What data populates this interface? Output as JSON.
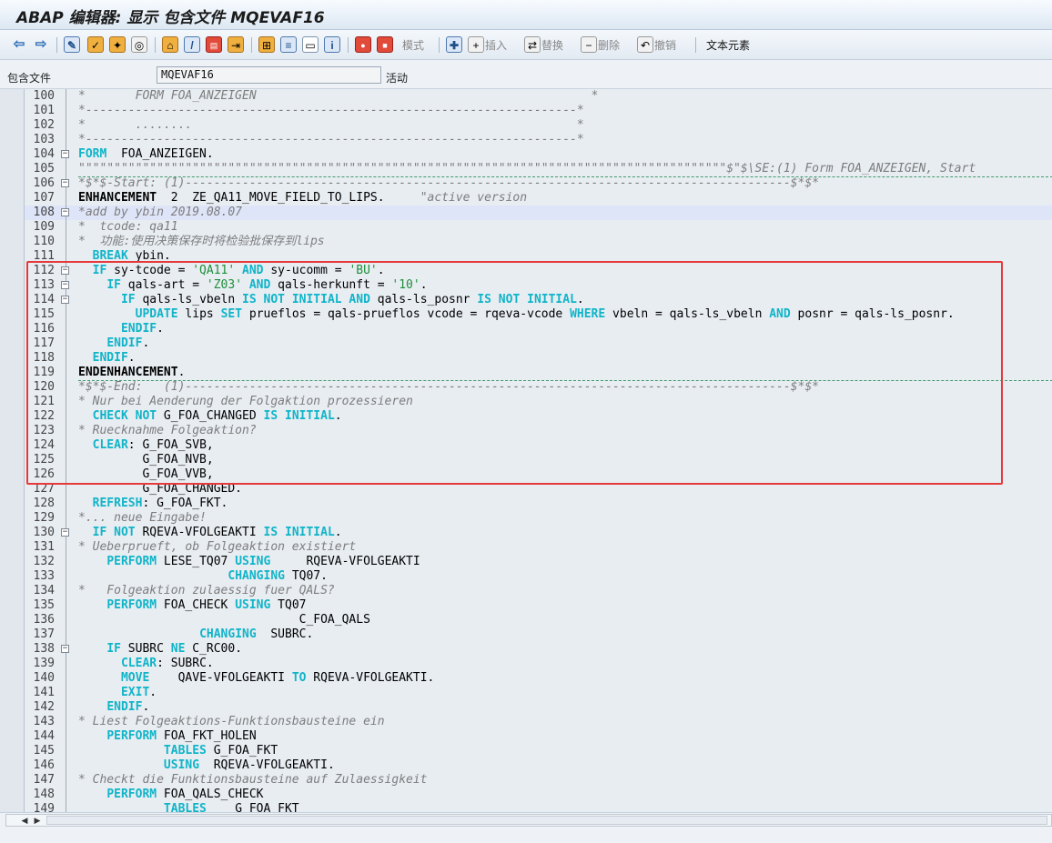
{
  "window": {
    "title": "ABAP 编辑器: 显示 包含文件 MQEVAF16"
  },
  "toolbar": {
    "mode_label": "模式",
    "insert_label": "插入",
    "replace_label": "替换",
    "delete_label": "删除",
    "undo_label": "撤销",
    "text_elements_label": "文本元素"
  },
  "fields": {
    "include_label": "包含文件",
    "include_value": "MQEVAF16",
    "status_value": "活动"
  },
  "lines": [
    {
      "num": "100",
      "fold": "line",
      "segs": [
        [
          "cm",
          "*       FORM FOA_ANZEIGEN                                               *"
        ]
      ]
    },
    {
      "num": "101",
      "fold": "line",
      "segs": [
        [
          "cm",
          "*---------------------------------------------------------------------*"
        ]
      ]
    },
    {
      "num": "102",
      "fold": "line",
      "segs": [
        [
          "cm",
          "*       ........                                                      *"
        ]
      ]
    },
    {
      "num": "103",
      "fold": "line",
      "segs": [
        [
          "cm",
          "*---------------------------------------------------------------------*"
        ]
      ]
    },
    {
      "num": "104",
      "fold": "box",
      "segs": [
        [
          "kw",
          "FORM"
        ],
        [
          "",
          "  FOA_ANZEIGEN."
        ]
      ]
    },
    {
      "num": "105",
      "fold": "line",
      "segs": [
        [
          "cm",
          "\"\"\"\"\"\"\"\"\"\"\"\"\"\"\"\"\"\"\"\"\"\"\"\"\"\"\"\"\"\"\"\"\"\"\"\"\"\"\"\"\"\"\"\"\"\"\"\"\"\"\"\"\"\"\"\"\"\"\"\"\"\"\"\"\"\"\"\"\"\"\"\"\"\"\"\"\"\"\"\"\"\"\"\"\"\"\"\"\"\"\"$\"$\\SE:(1) Form FOA_ANZEIGEN, Start"
        ]
      ]
    },
    {
      "num": "106",
      "fold": "box",
      "segs": [
        [
          "cm",
          "*$*$-Start: (1)-------------------------------------------------------------------------------------$*$*"
        ]
      ]
    },
    {
      "num": "107",
      "fold": "line",
      "segs": [
        [
          "bk",
          "ENHANCEMENT"
        ],
        [
          "",
          "  2  ZE_QA11_MOVE_FIELD_TO_LIPS.     "
        ],
        [
          "cm",
          "\"active version"
        ]
      ]
    },
    {
      "num": "108",
      "fold": "box",
      "hl": true,
      "segs": [
        [
          "cm",
          "*add by ybin 2019.08.07"
        ]
      ]
    },
    {
      "num": "109",
      "fold": "line",
      "segs": [
        [
          "cm",
          "*  tcode: qa11"
        ]
      ]
    },
    {
      "num": "110",
      "fold": "line",
      "segs": [
        [
          "cm",
          "*  功能:使用决策保存时将检验批保存到lips"
        ]
      ]
    },
    {
      "num": "111",
      "fold": "line",
      "segs": [
        [
          "",
          "  "
        ],
        [
          "kw",
          "BREAK"
        ],
        [
          "",
          " ybin."
        ]
      ]
    },
    {
      "num": "112",
      "fold": "box",
      "segs": [
        [
          "",
          "  "
        ],
        [
          "kw",
          "IF"
        ],
        [
          "",
          " sy-tcode = "
        ],
        [
          "st",
          "'QA11'"
        ],
        [
          "",
          " "
        ],
        [
          "kw",
          "AND"
        ],
        [
          "",
          " sy-ucomm = "
        ],
        [
          "st",
          "'BU'"
        ],
        [
          "",
          "."
        ]
      ]
    },
    {
      "num": "113",
      "fold": "box",
      "segs": [
        [
          "",
          "    "
        ],
        [
          "kw",
          "IF"
        ],
        [
          "",
          " qals-art = "
        ],
        [
          "st",
          "'Z03'"
        ],
        [
          "",
          " "
        ],
        [
          "kw",
          "AND"
        ],
        [
          "",
          " qals-herkunft = "
        ],
        [
          "st",
          "'10'"
        ],
        [
          "",
          "."
        ]
      ]
    },
    {
      "num": "114",
      "fold": "box",
      "segs": [
        [
          "",
          "      "
        ],
        [
          "kw",
          "IF"
        ],
        [
          "",
          " qals-ls_vbeln "
        ],
        [
          "kw",
          "IS NOT INITIAL AND"
        ],
        [
          "",
          " qals-ls_posnr "
        ],
        [
          "kw",
          "IS NOT INITIAL"
        ],
        [
          "",
          "."
        ]
      ]
    },
    {
      "num": "115",
      "fold": "line",
      "segs": [
        [
          "",
          "        "
        ],
        [
          "kw",
          "UPDATE"
        ],
        [
          "",
          " lips "
        ],
        [
          "kw",
          "SET"
        ],
        [
          "",
          " prueflos = qals-prueflos vcode = rqeva-vcode "
        ],
        [
          "kw",
          "WHERE"
        ],
        [
          "",
          " vbeln = qals-ls_vbeln "
        ],
        [
          "kw",
          "AND"
        ],
        [
          "",
          " posnr = qals-ls_posnr."
        ]
      ]
    },
    {
      "num": "116",
      "fold": "line",
      "segs": [
        [
          "",
          "      "
        ],
        [
          "kw",
          "ENDIF"
        ],
        [
          "",
          "."
        ]
      ]
    },
    {
      "num": "117",
      "fold": "line",
      "segs": [
        [
          "",
          "    "
        ],
        [
          "kw",
          "ENDIF"
        ],
        [
          "",
          "."
        ]
      ]
    },
    {
      "num": "118",
      "fold": "line",
      "segs": [
        [
          "",
          "  "
        ],
        [
          "kw",
          "ENDIF"
        ],
        [
          "",
          "."
        ]
      ]
    },
    {
      "num": "119",
      "fold": "line",
      "segs": [
        [
          "bk",
          "ENDENHANCEMENT"
        ],
        [
          "",
          "."
        ]
      ]
    },
    {
      "num": "120",
      "fold": "line",
      "segs": [
        [
          "cm",
          "*$*$-End:   (1)-------------------------------------------------------------------------------------$*$*"
        ]
      ]
    },
    {
      "num": "121",
      "fold": "line",
      "segs": [
        [
          "cm",
          "* Nur bei Aenderung der Folgaktion prozessieren"
        ]
      ]
    },
    {
      "num": "122",
      "fold": "line",
      "segs": [
        [
          "",
          "  "
        ],
        [
          "kw",
          "CHECK NOT"
        ],
        [
          "",
          " G_FOA_CHANGED "
        ],
        [
          "kw",
          "IS INITIAL"
        ],
        [
          "",
          "."
        ]
      ]
    },
    {
      "num": "123",
      "fold": "line",
      "segs": [
        [
          "cm",
          "* Ruecknahme Folgeaktion?"
        ]
      ]
    },
    {
      "num": "124",
      "fold": "line",
      "segs": [
        [
          "",
          "  "
        ],
        [
          "kw",
          "CLEAR"
        ],
        [
          "",
          ": G_FOA_SVB,"
        ]
      ]
    },
    {
      "num": "125",
      "fold": "line",
      "segs": [
        [
          "",
          "         G_FOA_NVB,"
        ]
      ]
    },
    {
      "num": "126",
      "fold": "line",
      "segs": [
        [
          "",
          "         G_FOA_VVB,"
        ]
      ]
    },
    {
      "num": "127",
      "fold": "line",
      "segs": [
        [
          "",
          "         G_FOA_CHANGED."
        ]
      ]
    },
    {
      "num": "128",
      "fold": "line",
      "segs": [
        [
          "",
          "  "
        ],
        [
          "kw",
          "REFRESH"
        ],
        [
          "",
          ": G_FOA_FKT."
        ]
      ]
    },
    {
      "num": "129",
      "fold": "line",
      "segs": [
        [
          "cm",
          "*... neue Eingabe!"
        ]
      ]
    },
    {
      "num": "130",
      "fold": "box",
      "segs": [
        [
          "",
          "  "
        ],
        [
          "kw",
          "IF NOT"
        ],
        [
          "",
          " RQEVA-VFOLGEAKTI "
        ],
        [
          "kw",
          "IS INITIAL"
        ],
        [
          "",
          "."
        ]
      ]
    },
    {
      "num": "131",
      "fold": "line",
      "segs": [
        [
          "cm",
          "* Ueberprueft, ob Folgeaktion existiert"
        ]
      ]
    },
    {
      "num": "132",
      "fold": "line",
      "segs": [
        [
          "",
          "    "
        ],
        [
          "kw",
          "PERFORM"
        ],
        [
          "",
          " LESE_TQ07 "
        ],
        [
          "kw",
          "USING"
        ],
        [
          "",
          "     RQEVA-VFOLGEAKTI"
        ]
      ]
    },
    {
      "num": "133",
      "fold": "line",
      "segs": [
        [
          "",
          "                     "
        ],
        [
          "kw",
          "CHANGING"
        ],
        [
          "",
          " TQ07."
        ]
      ]
    },
    {
      "num": "134",
      "fold": "line",
      "segs": [
        [
          "cm",
          "*   Folgeaktion zulaessig fuer QALS?"
        ]
      ]
    },
    {
      "num": "135",
      "fold": "line",
      "segs": [
        [
          "",
          "    "
        ],
        [
          "kw",
          "PERFORM"
        ],
        [
          "",
          " FOA_CHECK "
        ],
        [
          "kw",
          "USING"
        ],
        [
          "",
          " TQ07"
        ]
      ]
    },
    {
      "num": "136",
      "fold": "line",
      "segs": [
        [
          "",
          "                               C_FOA_QALS"
        ]
      ]
    },
    {
      "num": "137",
      "fold": "line",
      "segs": [
        [
          "",
          "                 "
        ],
        [
          "kw",
          "CHANGING"
        ],
        [
          "",
          "  SUBRC."
        ]
      ]
    },
    {
      "num": "138",
      "fold": "box",
      "segs": [
        [
          "",
          "    "
        ],
        [
          "kw",
          "IF"
        ],
        [
          "",
          " SUBRC "
        ],
        [
          "kw",
          "NE"
        ],
        [
          "",
          " C_RC00."
        ]
      ]
    },
    {
      "num": "139",
      "fold": "line",
      "segs": [
        [
          "",
          "      "
        ],
        [
          "kw",
          "CLEAR"
        ],
        [
          "",
          ": SUBRC."
        ]
      ]
    },
    {
      "num": "140",
      "fold": "line",
      "segs": [
        [
          "",
          "      "
        ],
        [
          "kw",
          "MOVE"
        ],
        [
          "",
          "    QAVE-VFOLGEAKTI "
        ],
        [
          "kw",
          "TO"
        ],
        [
          "",
          " RQEVA-VFOLGEAKTI."
        ]
      ]
    },
    {
      "num": "141",
      "fold": "line",
      "segs": [
        [
          "",
          "      "
        ],
        [
          "kw",
          "EXIT"
        ],
        [
          "",
          "."
        ]
      ]
    },
    {
      "num": "142",
      "fold": "line",
      "segs": [
        [
          "",
          "    "
        ],
        [
          "kw",
          "ENDIF"
        ],
        [
          "",
          "."
        ]
      ]
    },
    {
      "num": "143",
      "fold": "line",
      "segs": [
        [
          "cm",
          "* Liest Folgeaktions-Funktionsbausteine ein"
        ]
      ]
    },
    {
      "num": "144",
      "fold": "line",
      "segs": [
        [
          "",
          "    "
        ],
        [
          "kw",
          "PERFORM"
        ],
        [
          "",
          " FOA_FKT_HOLEN"
        ]
      ]
    },
    {
      "num": "145",
      "fold": "line",
      "segs": [
        [
          "",
          "            "
        ],
        [
          "kw",
          "TABLES"
        ],
        [
          "",
          " G_FOA_FKT"
        ]
      ]
    },
    {
      "num": "146",
      "fold": "line",
      "segs": [
        [
          "",
          "            "
        ],
        [
          "kw",
          "USING"
        ],
        [
          "",
          "  RQEVA-VFOLGEAKTI."
        ]
      ]
    },
    {
      "num": "147",
      "fold": "line",
      "segs": [
        [
          "cm",
          "* Checkt die Funktionsbausteine auf Zulaessigkeit"
        ]
      ]
    },
    {
      "num": "148",
      "fold": "line",
      "segs": [
        [
          "",
          "    "
        ],
        [
          "kw",
          "PERFORM"
        ],
        [
          "",
          " FOA_QALS_CHECK"
        ]
      ]
    },
    {
      "num": "149",
      "fold": "line",
      "segs": [
        [
          "",
          "            "
        ],
        [
          "kw",
          "TABLES"
        ],
        [
          "",
          "    G_FOA_FKT"
        ]
      ]
    }
  ]
}
